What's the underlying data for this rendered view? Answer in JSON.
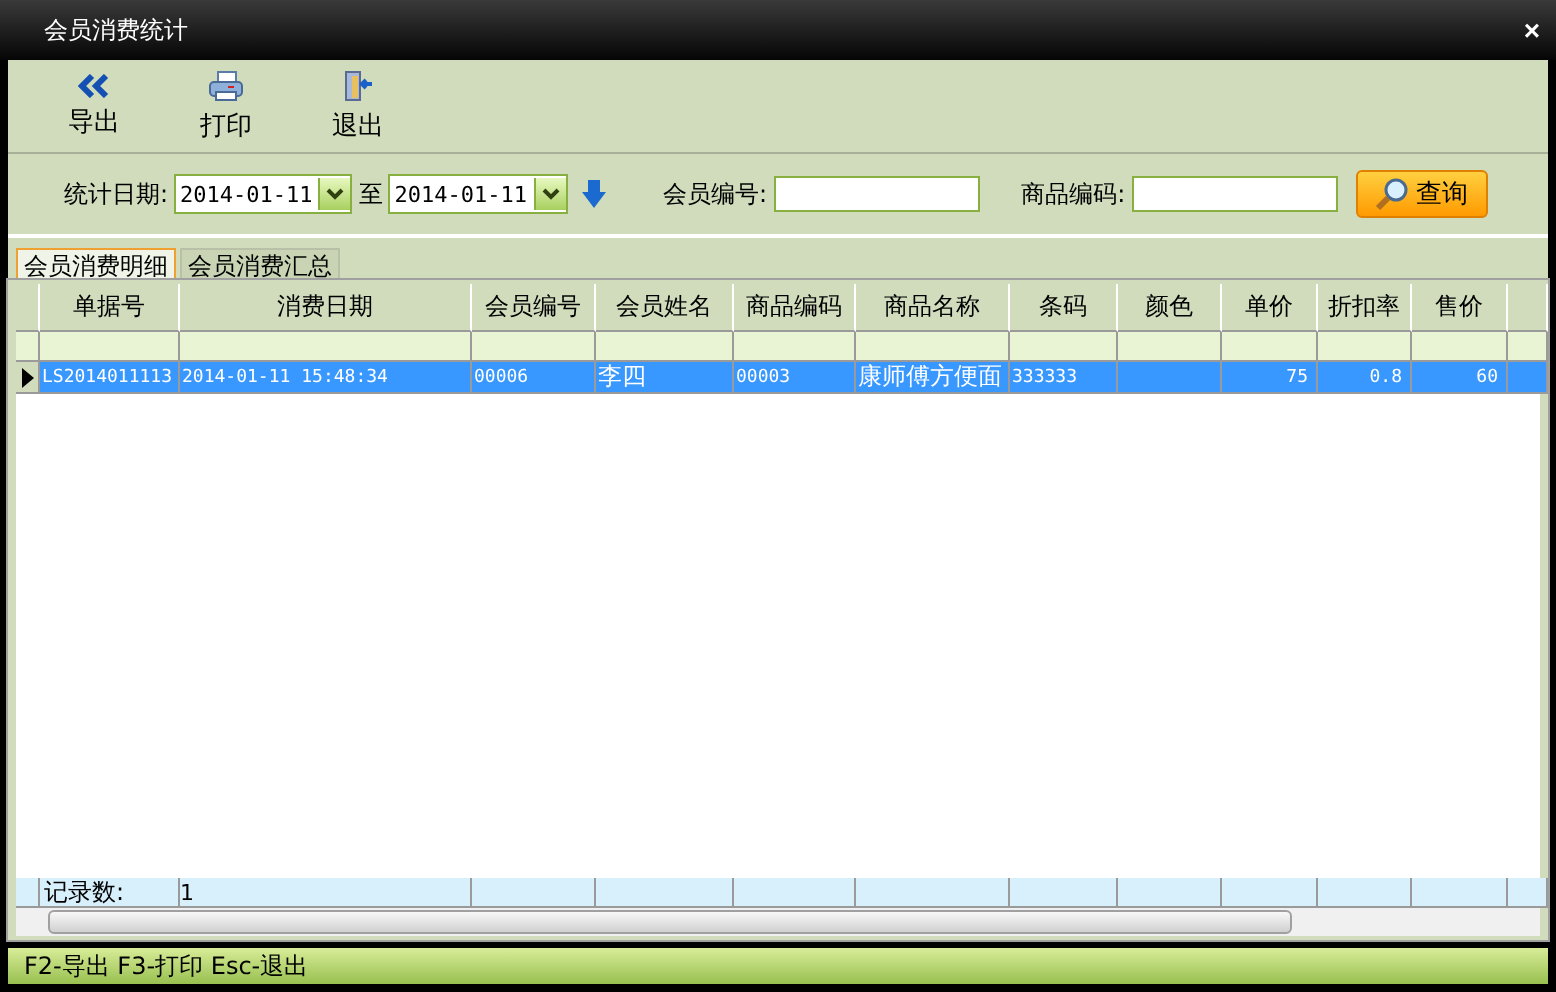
{
  "window": {
    "title": "会员消费统计",
    "close": "×"
  },
  "toolbar": [
    {
      "label": "导出",
      "kind": "export"
    },
    {
      "label": "打印",
      "kind": "print"
    },
    {
      "label": "退出",
      "kind": "exit"
    }
  ],
  "filters": {
    "date_label": "统计日期:",
    "date_from": "2014-01-11",
    "to_label": "至",
    "date_to": "2014-01-11",
    "member_label": "会员编号:",
    "product_label": "商品编码:",
    "search_button": "查询"
  },
  "tabs": [
    {
      "label": "会员消费明细",
      "selected": true
    },
    {
      "label": "会员消费汇总",
      "selected": false
    }
  ],
  "table": {
    "columns": [
      "单据号",
      "消费日期",
      "会员编号",
      "会员姓名",
      "商品编码",
      "商品名称",
      "条码",
      "颜色",
      "单价",
      "折扣率",
      "售价"
    ],
    "rows": [
      {
        "selected": true,
        "cells": [
          "LS2014011113",
          "2014-01-11 15:48:34",
          "00006",
          "李四",
          "00003",
          "康师傅方便面",
          "333333",
          null,
          "75",
          "0.8",
          "60"
        ]
      }
    ],
    "summary": {
      "label": "记录数:",
      "value": "1"
    }
  },
  "status_bar": "F2-导出 F3-打印 Esc-退出"
}
